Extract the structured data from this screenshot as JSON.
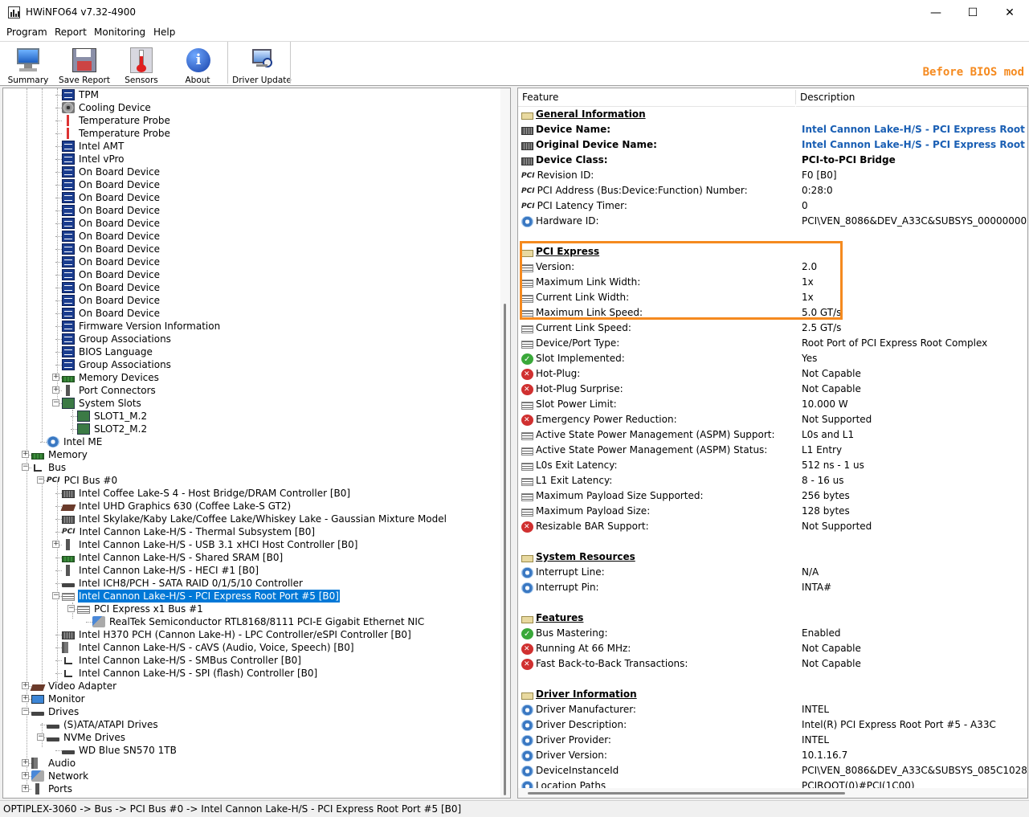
{
  "window": {
    "title": "HWiNFO64 v7.32-4900",
    "minimize": "—",
    "maximize": "☐",
    "close": "✕"
  },
  "menu": [
    "Program",
    "Report",
    "Monitoring",
    "Help"
  ],
  "toolbar": {
    "summary": "Summary",
    "save_report": "Save Report",
    "sensors": "Sensors",
    "about": "About",
    "driver_update": "Driver Update"
  },
  "banner": "Before BIOS mod",
  "tree": [
    {
      "label": "TPM",
      "icon": "dmi-icon"
    },
    {
      "label": "Cooling Device",
      "icon": "fan-icon"
    },
    {
      "label": "Temperature Probe",
      "icon": "thermometer-icon"
    },
    {
      "label": "Temperature Probe",
      "icon": "thermometer-icon"
    },
    {
      "label": "Intel AMT",
      "icon": "dmi-icon"
    },
    {
      "label": "Intel vPro",
      "icon": "dmi-icon"
    },
    {
      "label": "On Board Device",
      "icon": "dmi-icon"
    },
    {
      "label": "On Board Device",
      "icon": "dmi-icon"
    },
    {
      "label": "On Board Device",
      "icon": "dmi-icon"
    },
    {
      "label": "On Board Device",
      "icon": "dmi-icon"
    },
    {
      "label": "On Board Device",
      "icon": "dmi-icon"
    },
    {
      "label": "On Board Device",
      "icon": "dmi-icon"
    },
    {
      "label": "On Board Device",
      "icon": "dmi-icon"
    },
    {
      "label": "On Board Device",
      "icon": "dmi-icon"
    },
    {
      "label": "On Board Device",
      "icon": "dmi-icon"
    },
    {
      "label": "On Board Device",
      "icon": "dmi-icon"
    },
    {
      "label": "On Board Device",
      "icon": "dmi-icon"
    },
    {
      "label": "On Board Device",
      "icon": "dmi-icon"
    },
    {
      "label": "Firmware Version Information",
      "icon": "dmi-icon"
    },
    {
      "label": "Group Associations",
      "icon": "dmi-icon"
    },
    {
      "label": "BIOS Language",
      "icon": "dmi-icon"
    },
    {
      "label": "Group Associations",
      "icon": "dmi-icon"
    },
    {
      "label": "Memory Devices",
      "icon": "memory-icon"
    },
    {
      "label": "Port Connectors",
      "icon": "port-icon"
    },
    {
      "label": "System Slots",
      "icon": "slot-icon"
    },
    {
      "label": "SLOT1_M.2",
      "icon": "slot-icon"
    },
    {
      "label": "SLOT2_M.2",
      "icon": "slot-icon"
    },
    {
      "label": "Intel ME",
      "icon": "gear-icon"
    },
    {
      "label": "Memory",
      "icon": "memory-icon"
    },
    {
      "label": "Bus",
      "icon": "bus-icon"
    },
    {
      "label": "PCI Bus #0",
      "icon": "pci-icon"
    },
    {
      "label": "Intel Coffee Lake-S 4 - Host Bridge/DRAM Controller [B0]",
      "icon": "chip-icon"
    },
    {
      "label": "Intel UHD Graphics 630 (Coffee Lake-S GT2)",
      "icon": "gpu-icon"
    },
    {
      "label": "Intel Skylake/Kaby Lake/Coffee Lake/Whiskey Lake - Gaussian Mixture Model",
      "icon": "chip-icon"
    },
    {
      "label": "Intel Cannon Lake-H/S - Thermal Subsystem [B0]",
      "icon": "pci-icon"
    },
    {
      "label": "Intel Cannon Lake-H/S - USB 3.1 xHCI Host Controller [B0]",
      "icon": "usb-icon"
    },
    {
      "label": "Intel Cannon Lake-H/S - Shared SRAM [B0]",
      "icon": "memory-icon"
    },
    {
      "label": "Intel Cannon Lake-H/S - HECI #1 [B0]",
      "icon": "port-icon"
    },
    {
      "label": "Intel ICH8/PCH - SATA RAID 0/1/5/10 Controller",
      "icon": "drive-icon"
    },
    {
      "label": "Intel Cannon Lake-H/S - PCI Express Root Port #5 [B0]",
      "icon": "pcie-icon"
    },
    {
      "label": "PCI Express x1 Bus #1",
      "icon": "pcie-icon"
    },
    {
      "label": "RealTek Semiconductor RTL8168/8111 PCI-E Gigabit Ethernet NIC",
      "icon": "network-icon"
    },
    {
      "label": "Intel H370 PCH (Cannon Lake-H) - LPC Controller/eSPI Controller [B0]",
      "icon": "chip-icon"
    },
    {
      "label": "Intel Cannon Lake-H/S - cAVS (Audio, Voice, Speech) [B0]",
      "icon": "speaker-icon"
    },
    {
      "label": "Intel Cannon Lake-H/S - SMBus Controller [B0]",
      "icon": "bus-icon"
    },
    {
      "label": "Intel Cannon Lake-H/S - SPI (flash) Controller [B0]",
      "icon": "bus-icon"
    },
    {
      "label": "Video Adapter",
      "icon": "gpu-icon"
    },
    {
      "label": "Monitor",
      "icon": "monitor-icon"
    },
    {
      "label": "Drives",
      "icon": "drive-icon"
    },
    {
      "label": "(S)ATA/ATAPI Drives",
      "icon": "drive-icon"
    },
    {
      "label": "NVMe Drives",
      "icon": "drive-icon"
    },
    {
      "label": "WD Blue SN570 1TB",
      "icon": "drive-icon"
    },
    {
      "label": "Audio",
      "icon": "speaker-icon"
    },
    {
      "label": "Network",
      "icon": "network-icon"
    },
    {
      "label": "Ports",
      "icon": "port-icon"
    }
  ],
  "details": {
    "col_feature": "Feature",
    "col_description": "Description",
    "rows": [
      {
        "feature": "General Information",
        "value": "",
        "icon": "book-icon",
        "style": "section"
      },
      {
        "feature": "Device Name:",
        "value": "Intel Cannon Lake-H/S - PCI Express Root",
        "icon": "chip-icon",
        "style": "bold-link"
      },
      {
        "feature": "Original Device Name:",
        "value": "Intel Cannon Lake-H/S - PCI Express Root",
        "icon": "chip-icon",
        "style": "bold-link"
      },
      {
        "feature": "Device Class:",
        "value": "PCI-to-PCI Bridge",
        "icon": "chip-icon",
        "style": "bold"
      },
      {
        "feature": "Revision ID:",
        "value": "F0 [B0]",
        "icon": "pci-icon",
        "style": ""
      },
      {
        "feature": "PCI Address (Bus:Device:Function) Number:",
        "value": "0:28:0",
        "icon": "pci-icon",
        "style": ""
      },
      {
        "feature": "PCI Latency Timer:",
        "value": "0",
        "icon": "pci-icon",
        "style": ""
      },
      {
        "feature": "Hardware ID:",
        "value": "PCI\\VEN_8086&DEV_A33C&SUBSYS_00000000",
        "icon": "gear-icon",
        "style": ""
      },
      {
        "feature": "",
        "value": "",
        "icon": "",
        "style": "blank"
      },
      {
        "feature": "PCI Express",
        "value": "",
        "icon": "book-icon",
        "style": "section"
      },
      {
        "feature": "Version:",
        "value": "2.0",
        "icon": "pcie-icon",
        "style": ""
      },
      {
        "feature": "Maximum Link Width:",
        "value": "1x",
        "icon": "pcie-icon",
        "style": ""
      },
      {
        "feature": "Current Link Width:",
        "value": "1x",
        "icon": "pcie-icon",
        "style": ""
      },
      {
        "feature": "Maximum Link Speed:",
        "value": "5.0 GT/s",
        "icon": "pcie-icon",
        "style": ""
      },
      {
        "feature": "Current Link Speed:",
        "value": "2.5 GT/s",
        "icon": "pcie-icon",
        "style": ""
      },
      {
        "feature": "Device/Port Type:",
        "value": "Root Port of PCI Express Root Complex",
        "icon": "pcie-icon",
        "style": ""
      },
      {
        "feature": "Slot Implemented:",
        "value": "Yes",
        "icon": "check-icon",
        "style": ""
      },
      {
        "feature": "Hot-Plug:",
        "value": "Not Capable",
        "icon": "cross-icon",
        "style": ""
      },
      {
        "feature": "Hot-Plug Surprise:",
        "value": "Not Capable",
        "icon": "cross-icon",
        "style": ""
      },
      {
        "feature": "Slot Power Limit:",
        "value": "10.000 W",
        "icon": "pcie-icon",
        "style": ""
      },
      {
        "feature": "Emergency Power Reduction:",
        "value": "Not Supported",
        "icon": "cross-icon",
        "style": ""
      },
      {
        "feature": "Active State Power Management (ASPM) Support:",
        "value": "L0s and L1",
        "icon": "pcie-icon",
        "style": ""
      },
      {
        "feature": "Active State Power Management (ASPM) Status:",
        "value": "L1 Entry",
        "icon": "pcie-icon",
        "style": ""
      },
      {
        "feature": "L0s Exit Latency:",
        "value": "512 ns - 1 us",
        "icon": "pcie-icon",
        "style": ""
      },
      {
        "feature": "L1 Exit Latency:",
        "value": "8 - 16 us",
        "icon": "pcie-icon",
        "style": ""
      },
      {
        "feature": "Maximum Payload Size Supported:",
        "value": "256 bytes",
        "icon": "pcie-icon",
        "style": ""
      },
      {
        "feature": "Maximum Payload Size:",
        "value": "128 bytes",
        "icon": "pcie-icon",
        "style": ""
      },
      {
        "feature": "Resizable BAR Support:",
        "value": "Not Supported",
        "icon": "cross-icon",
        "style": ""
      },
      {
        "feature": "",
        "value": "",
        "icon": "",
        "style": "blank"
      },
      {
        "feature": "System Resources",
        "value": "",
        "icon": "book-icon",
        "style": "section"
      },
      {
        "feature": "Interrupt Line:",
        "value": "N/A",
        "icon": "gear-icon",
        "style": ""
      },
      {
        "feature": "Interrupt Pin:",
        "value": "INTA#",
        "icon": "gear-icon",
        "style": ""
      },
      {
        "feature": "",
        "value": "",
        "icon": "",
        "style": "blank"
      },
      {
        "feature": "Features",
        "value": "",
        "icon": "book-icon",
        "style": "section"
      },
      {
        "feature": "Bus Mastering:",
        "value": "Enabled",
        "icon": "check-icon",
        "style": ""
      },
      {
        "feature": "Running At 66 MHz:",
        "value": "Not Capable",
        "icon": "cross-icon",
        "style": ""
      },
      {
        "feature": "Fast Back-to-Back Transactions:",
        "value": "Not Capable",
        "icon": "cross-icon",
        "style": ""
      },
      {
        "feature": "",
        "value": "",
        "icon": "",
        "style": "blank"
      },
      {
        "feature": "Driver Information",
        "value": "",
        "icon": "book-icon",
        "style": "section"
      },
      {
        "feature": "Driver Manufacturer:",
        "value": "INTEL",
        "icon": "gear-icon",
        "style": ""
      },
      {
        "feature": "Driver Description:",
        "value": "Intel(R) PCI Express Root Port #5 - A33C",
        "icon": "gear-icon",
        "style": ""
      },
      {
        "feature": "Driver Provider:",
        "value": "INTEL",
        "icon": "gear-icon",
        "style": ""
      },
      {
        "feature": "Driver Version:",
        "value": "10.1.16.7",
        "icon": "gear-icon",
        "style": ""
      },
      {
        "feature": "DeviceInstanceId",
        "value": "PCI\\VEN_8086&DEV_A33C&SUBSYS_085C1028",
        "icon": "gear-icon",
        "style": ""
      },
      {
        "feature": "Location Paths",
        "value": "PCIROOT(0)#PCI(1C00)",
        "icon": "gear-icon",
        "style": ""
      }
    ]
  },
  "status_bar": "OPTIPLEX-3060 -> Bus -> PCI Bus #0 -> Intel Cannon Lake-H/S - PCI Express Root Port #5 [B0]",
  "colors": {
    "accent": "#f58a1f",
    "selection": "#0078d7",
    "link": "#1a5fb4"
  }
}
